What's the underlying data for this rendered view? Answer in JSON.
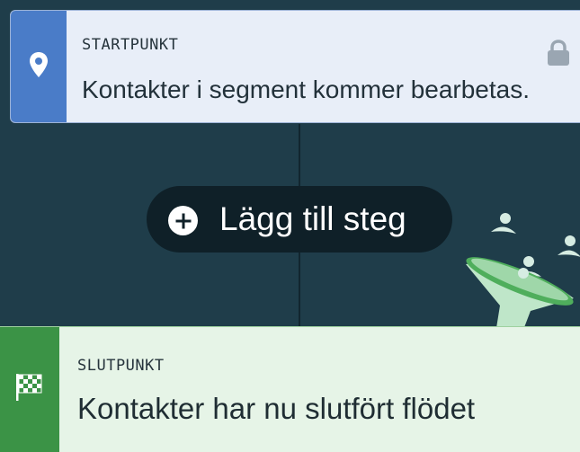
{
  "start_node": {
    "kicker": "STARTPUNKT",
    "description": "Kontakter i segment kommer bearbetas.",
    "icon": "map-pin-icon",
    "lock_icon": "lock-icon",
    "accent_color": "#4a7cc8"
  },
  "add_step": {
    "label": "Lägg till steg",
    "icon": "plus-circle-icon"
  },
  "illustration": {
    "icon": "funnel-icon"
  },
  "end_node": {
    "kicker": "SLUTPUNKT",
    "description": "Kontakter har nu slutfört flödet",
    "icon": "checkered-flag-icon",
    "accent_color": "#3b9346"
  }
}
